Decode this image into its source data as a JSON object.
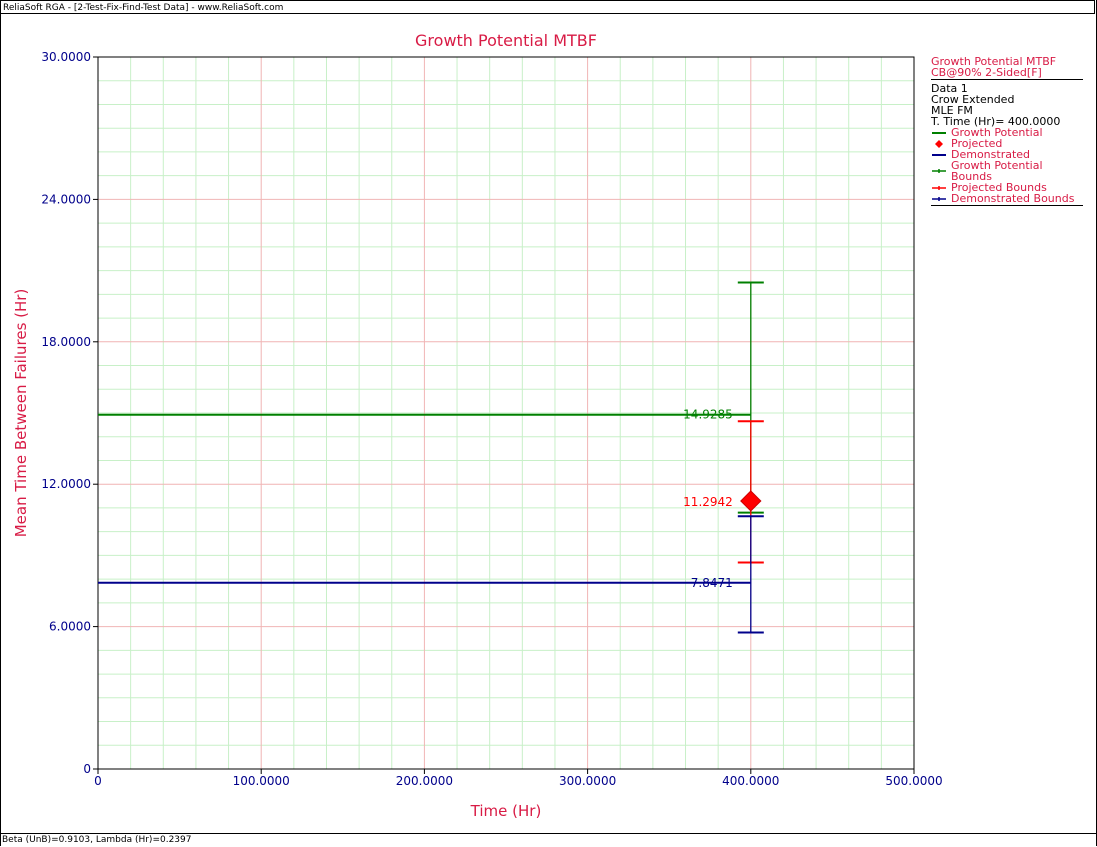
{
  "window": {
    "title": "ReliaSoft RGA - [2-Test-Fix-Find-Test Data] - www.ReliaSoft.com",
    "status": "Beta (UnB)=0.9103, Lambda (Hr)=0.2397"
  },
  "legend": {
    "title": "Growth Potential MTBF",
    "subtitle": "CB@90% 2-Sided[F]",
    "info": [
      "Data 1",
      "Crow Extended",
      "MLE FM",
      "T. Time (Hr)= 400.0000"
    ],
    "items": [
      {
        "label": "Growth Potential",
        "color": "#008000",
        "marker": "line"
      },
      {
        "label": "Projected",
        "color": "#ff0000",
        "marker": "diamond"
      },
      {
        "label": "Demonstrated",
        "color": "#00008b",
        "marker": "line"
      },
      {
        "label": "Growth Potential Bounds",
        "color": "#008000",
        "marker": "bound"
      },
      {
        "label": "Projected Bounds",
        "color": "#ff0000",
        "marker": "bound"
      },
      {
        "label": "Demonstrated Bounds",
        "color": "#00008b",
        "marker": "bound"
      }
    ]
  },
  "chart_data": {
    "type": "line",
    "title": "Growth Potential MTBF",
    "xlabel": "Time (Hr)",
    "ylabel": "Mean Time Between Failures (Hr)",
    "xlim": [
      0,
      500
    ],
    "ylim": [
      0,
      30
    ],
    "x_ticks": [
      "0",
      "100.0000",
      "200.0000",
      "300.0000",
      "400.0000",
      "500.0000"
    ],
    "y_ticks": [
      "0",
      "6.0000",
      "12.0000",
      "18.0000",
      "24.0000",
      "30.0000"
    ],
    "grid": true,
    "legend_position": "right",
    "series": [
      {
        "name": "Growth Potential",
        "color": "#008000",
        "x": [
          0,
          400
        ],
        "y": [
          14.9285,
          14.9285
        ],
        "label": "14.9285"
      },
      {
        "name": "Demonstrated",
        "color": "#00008b",
        "x": [
          0,
          400
        ],
        "y": [
          7.8471,
          7.8471
        ],
        "label": "7.8471"
      },
      {
        "name": "Projected",
        "color": "#ff0000",
        "x": [
          400
        ],
        "y": [
          11.2942
        ],
        "label": "11.2942"
      }
    ],
    "bounds": [
      {
        "name": "Growth Potential Bounds",
        "color": "#008000",
        "x": 400,
        "lower": 10.8,
        "upper": 20.5
      },
      {
        "name": "Projected Bounds",
        "color": "#ff0000",
        "x": 400,
        "lower": 8.7,
        "upper": 14.65
      },
      {
        "name": "Demonstrated Bounds",
        "color": "#00008b",
        "x": 400,
        "lower": 5.75,
        "upper": 10.65
      }
    ],
    "colors": {
      "title": "#d81b45",
      "axis_text": "#00008b",
      "minor_grid": "#c8f0c8",
      "major_grid": "#f0b4b4"
    }
  }
}
